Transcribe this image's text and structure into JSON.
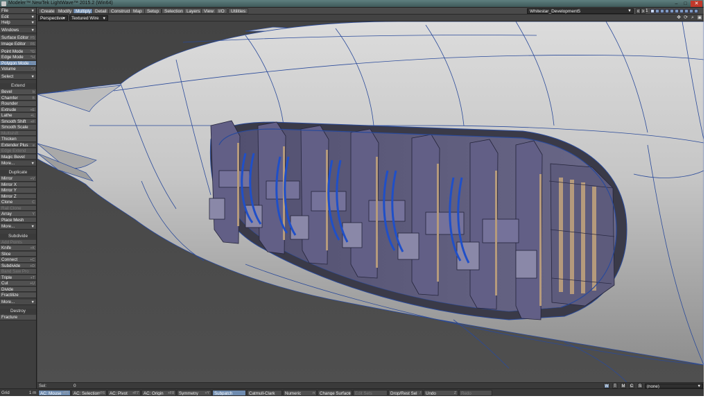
{
  "window": {
    "title": "Modeler™ NewTek LightWave™ 2015.2 (Win64)",
    "minimize": "–",
    "maximize": "□",
    "close": "✕"
  },
  "tabs": [
    "Create",
    "Modify",
    "Multiply",
    "Detail",
    "Construct",
    "Map",
    "Setup",
    "Selection",
    "Layers",
    "View",
    "I/O",
    "Utilities"
  ],
  "active_tab": "Multiply",
  "layer_select": "Whitestar_Development5",
  "layer_bank": "1",
  "sidebar": {
    "menus": [
      {
        "label": "File",
        "kind": "dropdown"
      },
      {
        "label": "Edit",
        "kind": "dropdown"
      },
      {
        "label": "Help",
        "kind": "dropdown"
      },
      {
        "label": "Windows",
        "kind": "dropdown"
      }
    ],
    "editors": [
      {
        "label": "Surface Editor",
        "shortcut": "F5"
      },
      {
        "label": "Image Editor",
        "shortcut": "F6"
      }
    ],
    "modes": [
      {
        "label": "Point Mode",
        "shortcut": "^G"
      },
      {
        "label": "Edge Mode",
        "shortcut": "^H"
      },
      {
        "label": "Polygon Mode",
        "shortcut": "^J",
        "active": true
      },
      {
        "label": "Volume",
        "shortcut": "^J"
      }
    ],
    "select": "Select",
    "extend_header": "Extend",
    "extend": [
      {
        "label": "Bevel",
        "shortcut": "b"
      },
      {
        "label": "Chamfer",
        "shortcut": "B"
      },
      {
        "label": "Rounder",
        "shortcut": ""
      },
      {
        "label": "Extrude",
        "shortcut": "+E"
      },
      {
        "label": "Lathe",
        "shortcut": "+L"
      },
      {
        "label": "Smooth Shift",
        "shortcut": "+F"
      },
      {
        "label": "Smooth Scale",
        "shortcut": ""
      },
      {
        "label": "Multishift",
        "shortcut": "",
        "disabled": true
      },
      {
        "label": "Thicken",
        "shortcut": ""
      },
      {
        "label": "Extender Plus",
        "shortcut": "e"
      },
      {
        "label": "Edge Extend",
        "shortcut": "",
        "disabled": true
      },
      {
        "label": "Magic Bevel",
        "shortcut": ""
      },
      {
        "label": "More...",
        "kind": "dropdown"
      }
    ],
    "duplicate_header": "Duplicate",
    "duplicate": [
      {
        "label": "Mirror",
        "shortcut": "+V"
      },
      {
        "label": "Mirror X",
        "shortcut": ""
      },
      {
        "label": "Mirror Y",
        "shortcut": ""
      },
      {
        "label": "Mirror Z",
        "shortcut": ""
      },
      {
        "label": "Clone",
        "shortcut": "C"
      },
      {
        "label": "Rail Clone",
        "shortcut": "",
        "disabled": true
      },
      {
        "label": "Array",
        "shortcut": "Y"
      },
      {
        "label": "Place Mesh",
        "shortcut": ""
      },
      {
        "label": "More...",
        "kind": "dropdown"
      }
    ],
    "subdivide_header": "Subdivide",
    "subdivide": [
      {
        "label": "Add Points",
        "shortcut": "",
        "disabled": true
      },
      {
        "label": "Knife",
        "shortcut": "+K"
      },
      {
        "label": "Slice",
        "shortcut": ""
      },
      {
        "label": "Connect",
        "shortcut": "+C"
      },
      {
        "label": "Subdivide",
        "shortcut": "+D"
      },
      {
        "label": "Band Saw Pro",
        "shortcut": "",
        "disabled": true
      },
      {
        "label": "Triple",
        "shortcut": "+T"
      },
      {
        "label": "Cut",
        "shortcut": "+U"
      },
      {
        "label": "Divide",
        "shortcut": ""
      },
      {
        "label": "Fractilize",
        "shortcut": ""
      },
      {
        "label": "More...",
        "kind": "dropdown"
      }
    ],
    "destroy_header": "Destroy",
    "destroy": [
      {
        "label": "Fracture",
        "shortcut": ""
      }
    ]
  },
  "viewport": {
    "view_type": "Perspective",
    "render_style": "Textured Wire"
  },
  "sel_row": {
    "label": "Sel:",
    "value": "0",
    "toggles": [
      "W",
      "T",
      "M",
      "C",
      "S"
    ],
    "active_toggle": "W",
    "surface": "(none)"
  },
  "statusbar": {
    "grid_label": "Grid",
    "grid_value": "1 m",
    "items": [
      {
        "label": "AC: Mouse",
        "shortcut": "+F5",
        "active": true
      },
      {
        "label": "AC: Selection",
        "shortcut": "+F6"
      },
      {
        "label": "AC: Pivot",
        "shortcut": "+F7"
      },
      {
        "label": "AC: Origin",
        "shortcut": "+F8"
      },
      {
        "label": "Symmetry",
        "shortcut": "+Y"
      },
      {
        "label": "Subpatch",
        "shortcut": "",
        "active": true
      },
      {
        "label": "Catmull-Clark",
        "shortcut": ""
      },
      {
        "label": "Numeric",
        "shortcut": "n"
      },
      {
        "label": "Change Surface",
        "shortcut": "q"
      },
      {
        "label": "Edit Sets",
        "shortcut": "",
        "disabled": true
      },
      {
        "label": "Drop/Rest Sel",
        "shortcut": "/"
      },
      {
        "label": "Undo",
        "shortcut": "Z"
      },
      {
        "label": "Redo",
        "shortcut": "",
        "disabled": true
      }
    ]
  },
  "colors": {
    "accent": "#6f8cb0",
    "hull": "#c9c9c9",
    "wire": "#2a4a9a",
    "detail": "#5d5c7e"
  }
}
